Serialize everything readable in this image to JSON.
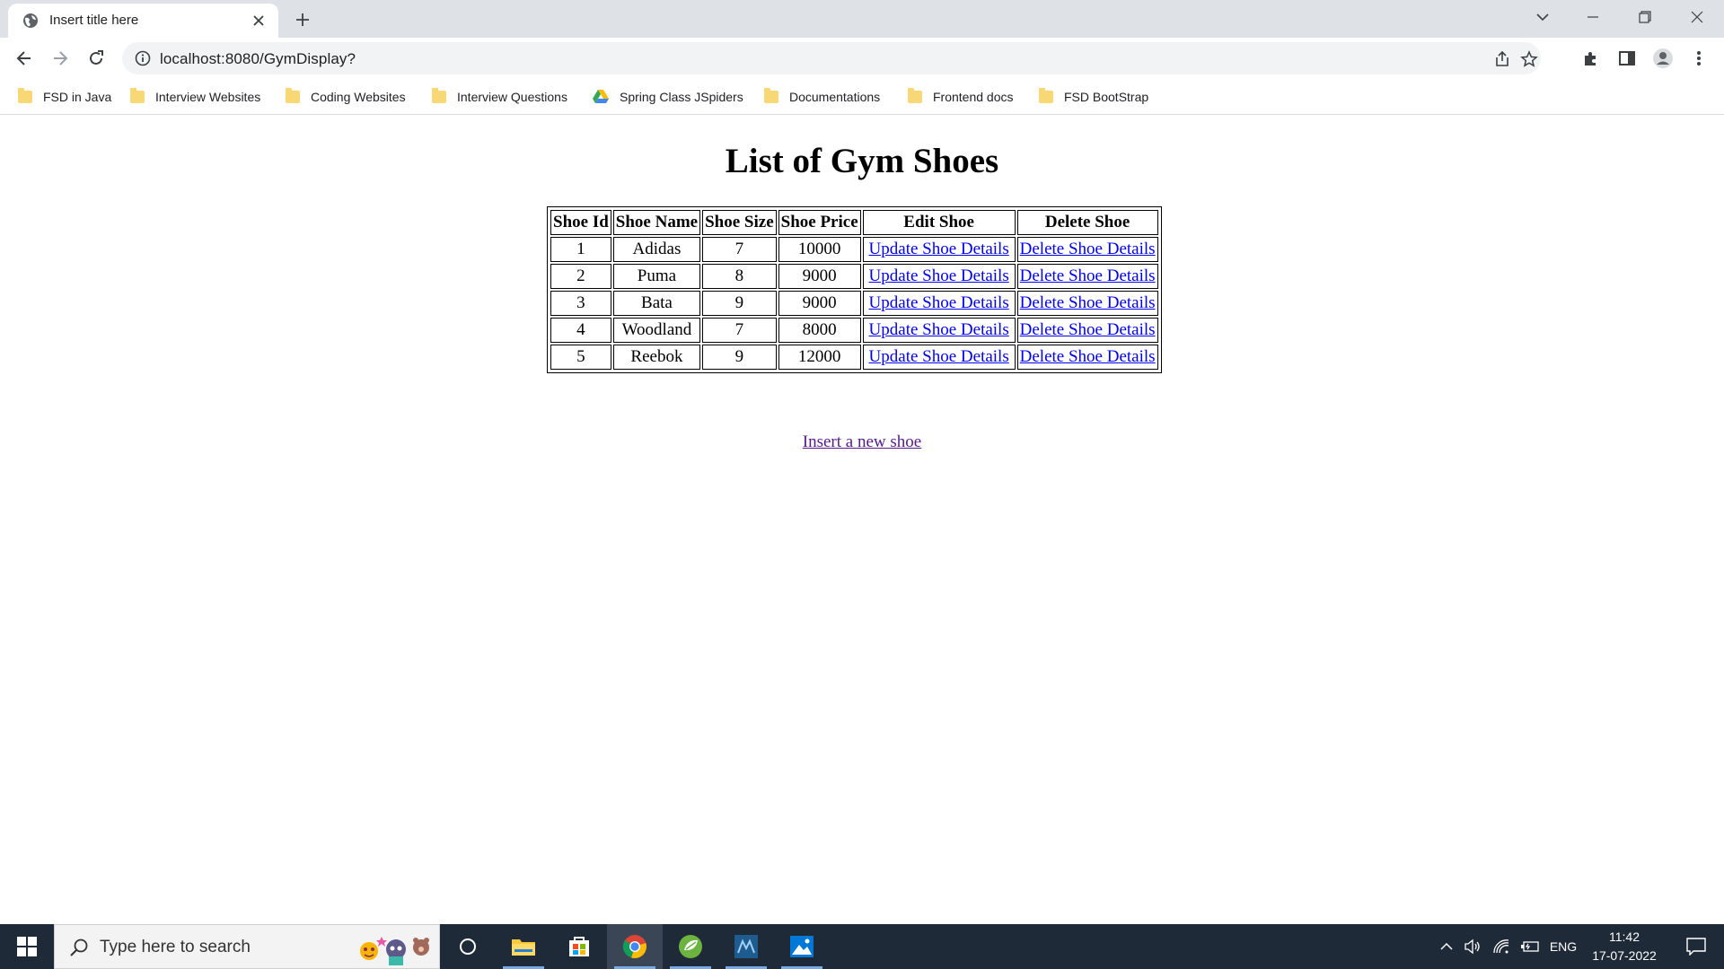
{
  "browser": {
    "tab_title": "Insert title here",
    "url": "localhost:8080/GymDisplay?",
    "bookmarks": [
      {
        "label": "FSD in Java",
        "icon": "folder-icon"
      },
      {
        "label": "Interview Websites",
        "icon": "folder-icon"
      },
      {
        "label": "Coding Websites",
        "icon": "folder-icon"
      },
      {
        "label": "Interview Questions",
        "icon": "folder-icon"
      },
      {
        "label": "Spring Class JSpiders",
        "icon": "google-drive-icon"
      },
      {
        "label": "Documentations",
        "icon": "folder-icon"
      },
      {
        "label": "Frontend docs",
        "icon": "folder-icon"
      },
      {
        "label": "FSD BootStrap",
        "icon": "folder-icon"
      }
    ]
  },
  "page": {
    "title": "List of Gym Shoes",
    "table": {
      "headers": [
        "Shoe Id",
        "Shoe Name",
        "Shoe Size",
        "Shoe Price",
        "Edit Shoe",
        "Delete Shoe"
      ],
      "rows": [
        {
          "id": "1",
          "name": "Adidas",
          "size": "7",
          "price": "10000",
          "edit": "Update Shoe Details",
          "delete": "Delete Shoe Details"
        },
        {
          "id": "2",
          "name": "Puma",
          "size": "8",
          "price": "9000",
          "edit": "Update Shoe Details",
          "delete": "Delete Shoe Details"
        },
        {
          "id": "3",
          "name": "Bata",
          "size": "9",
          "price": "9000",
          "edit": "Update Shoe Details",
          "delete": "Delete Shoe Details"
        },
        {
          "id": "4",
          "name": "Woodland",
          "size": "7",
          "price": "8000",
          "edit": "Update Shoe Details",
          "delete": "Delete Shoe Details"
        },
        {
          "id": "5",
          "name": "Reebok",
          "size": "9",
          "price": "12000",
          "edit": "Update Shoe Details",
          "delete": "Delete Shoe Details"
        }
      ]
    },
    "insert_link": "Insert a new shoe"
  },
  "taskbar": {
    "search_placeholder": "Type here to search",
    "language": "ENG",
    "time": "11:42",
    "date": "17-07-2022"
  },
  "colors": {
    "link": "#0000ee",
    "visited_link": "#551a8b",
    "taskbar": "#1f2a38",
    "tabstrip": "#dee1e6"
  }
}
